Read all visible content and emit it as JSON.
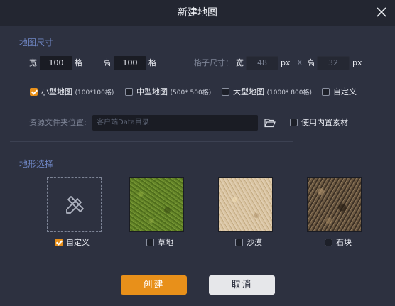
{
  "window": {
    "title": "新建地图"
  },
  "map_size": {
    "section_title": "地图尺寸",
    "width_label": "宽",
    "width_value": "100",
    "width_unit": "格",
    "height_label": "高",
    "height_value": "100",
    "height_unit": "格",
    "grid_size_label": "格子尺寸：",
    "grid_w_label": "宽",
    "grid_w_value": "48",
    "grid_w_unit": "px",
    "x_sep": "X",
    "grid_h_label": "高",
    "grid_h_value": "32",
    "grid_h_unit": "px"
  },
  "size_options": [
    {
      "label": "小型地图",
      "hint": "(100*100格)",
      "checked": true
    },
    {
      "label": "中型地图",
      "hint": "(500* 500格)",
      "checked": false
    },
    {
      "label": "大型地图",
      "hint": "(1000* 800格)",
      "checked": false
    },
    {
      "label": "自定义",
      "hint": "",
      "checked": false
    }
  ],
  "resource": {
    "folder_label": "资源文件夹位置:",
    "folder_placeholder": "客户端Data目录",
    "builtin_label": "使用内置素材",
    "builtin_checked": false
  },
  "terrain": {
    "section_title": "地形选择",
    "items": [
      {
        "label": "自定义",
        "checked": true
      },
      {
        "label": "草地",
        "checked": false
      },
      {
        "label": "沙漠",
        "checked": false
      },
      {
        "label": "石块",
        "checked": false
      }
    ]
  },
  "buttons": {
    "create": "创建",
    "cancel": "取消"
  },
  "colors": {
    "accent": "#e8901a",
    "background": "#2d3140",
    "section_title": "#6f86c4"
  }
}
